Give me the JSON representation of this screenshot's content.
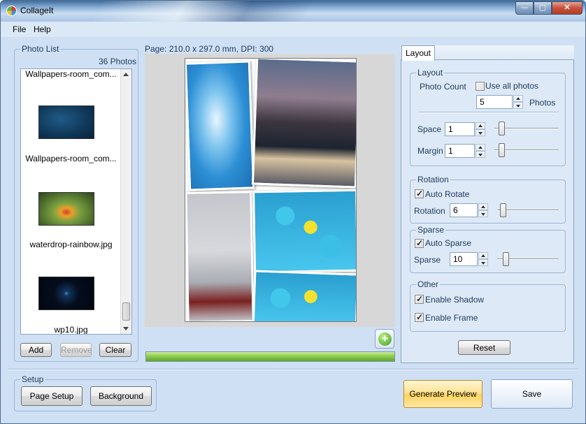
{
  "window": {
    "title": "CollageIt"
  },
  "menu": {
    "file": "File",
    "help": "Help"
  },
  "photo_list": {
    "legend": "Photo List",
    "count": "36 Photos",
    "items": [
      {
        "label": "Wallpapers-room_com...",
        "thumb": "partial-top"
      },
      {
        "label": "Wallpapers-room_com...",
        "thumb": "blue-texture"
      },
      {
        "label": "waterdrop-rainbow.jpg",
        "thumb": "waterdrop"
      },
      {
        "label": "wp10.jpg",
        "thumb": "dark-logo"
      }
    ],
    "add": "Add",
    "remove": "Remove",
    "clear": "Clear"
  },
  "preview": {
    "page_info": "Page: 210.0 x 297.0 mm, DPI: 300",
    "progress_fraction": 1.0
  },
  "layout_tab": {
    "tab": "Layout",
    "layout": {
      "legend": "Layout",
      "photo_count_label": "Photo Count",
      "use_all_photos": "Use all photos",
      "use_all_checked": false,
      "photos_value": "5",
      "photos_unit": "Photos",
      "space_label": "Space",
      "space_value": "1",
      "margin_label": "Margin",
      "margin_value": "1"
    },
    "rotation": {
      "legend": "Rotation",
      "auto_rotate": "Auto Rotate",
      "auto_rotate_checked": true,
      "rotation_label": "Rotation",
      "rotation_value": "6"
    },
    "sparse": {
      "legend": "Sparse",
      "auto_sparse": "Auto Sparse",
      "auto_sparse_checked": true,
      "sparse_label": "Sparse",
      "sparse_value": "10"
    },
    "other": {
      "legend": "Other",
      "enable_shadow": "Enable Shadow",
      "enable_shadow_checked": true,
      "enable_frame": "Enable Frame",
      "enable_frame_checked": true
    },
    "reset": "Reset"
  },
  "setup": {
    "legend": "Setup",
    "page_setup": "Page Setup",
    "background": "Background"
  },
  "actions": {
    "generate_preview": "Generate Preview",
    "save": "Save"
  },
  "colors": {
    "accent": "#cfe0f4",
    "progress": "#5ea629",
    "generate": "#ffd35a"
  }
}
